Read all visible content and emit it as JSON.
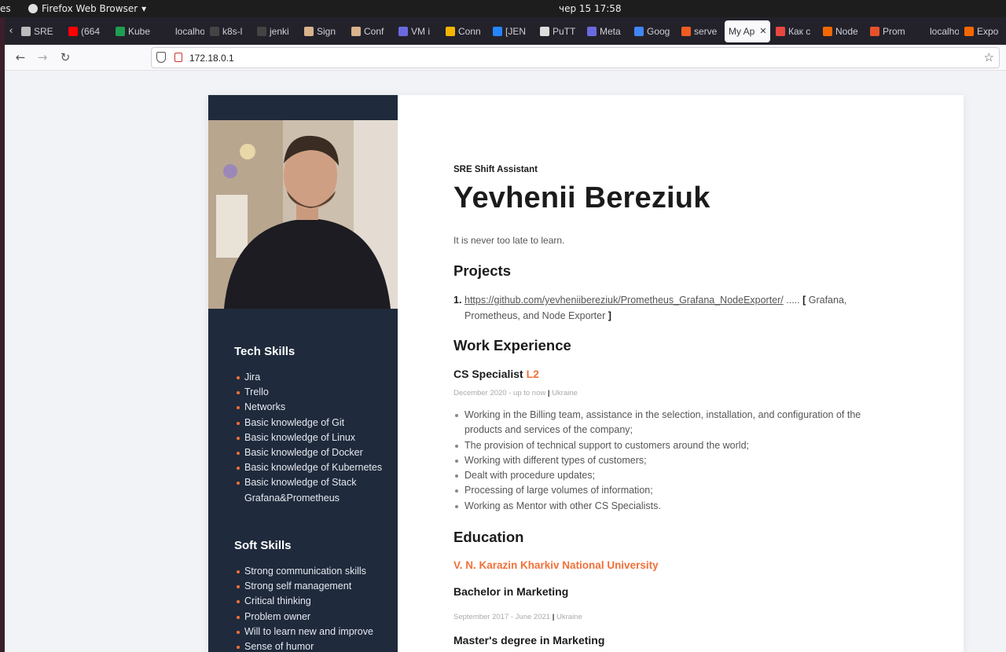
{
  "system": {
    "activities": "es",
    "app_name": "Firefox Web Browser",
    "app_menu_arrow": "▾",
    "clock": "чер 15  17:58"
  },
  "browser": {
    "tabs": [
      {
        "label": "SRE",
        "icon": "doc-icon",
        "color": "#bbbbbb"
      },
      {
        "label": "(664",
        "icon": "youtube-icon",
        "color": "#ff0000"
      },
      {
        "label": "Kube",
        "icon": "sheets-icon",
        "color": "#1e9e52"
      },
      {
        "label": "localhos",
        "icon": "blank-icon",
        "color": "#23222b"
      },
      {
        "label": "k8s-l",
        "icon": "github-icon",
        "color": "#444444"
      },
      {
        "label": "jenki",
        "icon": "github-icon",
        "color": "#444444"
      },
      {
        "label": "Sign",
        "icon": "jenkins-icon",
        "color": "#d9b38c"
      },
      {
        "label": "Conf",
        "icon": "jenkins-icon",
        "color": "#d9b38c"
      },
      {
        "label": "VM i",
        "icon": "vm-icon",
        "color": "#6a6ae0"
      },
      {
        "label": "Conn",
        "icon": "chrome-icon",
        "color": "#f4b400"
      },
      {
        "label": "[JEN",
        "icon": "jira-icon",
        "color": "#2684ff"
      },
      {
        "label": "PuTT",
        "icon": "putty-icon",
        "color": "#dddddd"
      },
      {
        "label": "Meta",
        "icon": "vm-icon",
        "color": "#6a6ae0"
      },
      {
        "label": "Goog",
        "icon": "translate-icon",
        "color": "#4285f4"
      },
      {
        "label": "serve",
        "icon": "ask-icon",
        "color": "#f25c22"
      },
      {
        "label": "My Ap",
        "icon": "none",
        "color": "#f9f9fb",
        "active": true
      },
      {
        "label": "Как с",
        "icon": "pinwheel-icon",
        "color": "#e8483f"
      },
      {
        "label": "Node",
        "icon": "grafana-icon",
        "color": "#f46800"
      },
      {
        "label": "Prom",
        "icon": "prometheus-icon",
        "color": "#e6522c"
      },
      {
        "label": "localhos",
        "icon": "blank-icon",
        "color": "#23222b"
      },
      {
        "label": "Expo",
        "icon": "grafana-icon",
        "color": "#f46800"
      }
    ],
    "close_tab": "✕",
    "back": "←",
    "forward": "→",
    "reload": "↻",
    "url": "172.18.0.1",
    "bookmark_star": "☆"
  },
  "resume": {
    "tech_skills_title": "Tech Skills",
    "tech_skills": [
      "Jira",
      "Trello",
      "Networks",
      "Basic knowledge of Git",
      "Basic knowledge of Linux",
      "Basic knowledge of Docker",
      "Basic knowledge of Kubernetes",
      "Basic knowledge of Stack Grafana&Prometheus"
    ],
    "soft_skills_title": "Soft Skills",
    "soft_skills": [
      "Strong communication skills",
      "Strong self management",
      "Critical thinking",
      "Problem owner",
      "Will to learn new and improve",
      "Sense of humor"
    ],
    "role": "SRE Shift Assistant",
    "name": "Yevhenii Bereziuk",
    "motto": "It is never too late to learn.",
    "projects_title": "Projects",
    "project": {
      "number": "1.",
      "link": "https://github.com/yevheniibereziuk/Prometheus_Grafana_NodeExporter/",
      "dots": " ..... ",
      "bracket_open": "[",
      "description": " Grafana, Prometheus, and Node Exporter ",
      "bracket_close": "]"
    },
    "work_title": "Work Experience",
    "job": {
      "title": "CS Specialist ",
      "level": "L2",
      "dates": "December 2020 - up to now",
      "sep": "|",
      "location": "Ukraine",
      "duties": [
        "Working in the Billing team, assistance in the selection, installation, and configuration of the products and services of the company;",
        "The provision of technical support to customers around the world;",
        "Working with different types of customers;",
        "Dealt with procedure updates;",
        "Processing of large volumes of information;",
        "Working as Mentor with other CS Specialists."
      ]
    },
    "education_title": "Education",
    "university": "V. N. Karazin Kharkiv National University",
    "bachelor": {
      "degree": "Bachelor in Marketing",
      "dates": "September 2017 - June 2021",
      "sep": "|",
      "location": "Ukraine"
    },
    "master": {
      "degree": "Master's degree in Marketing"
    }
  }
}
